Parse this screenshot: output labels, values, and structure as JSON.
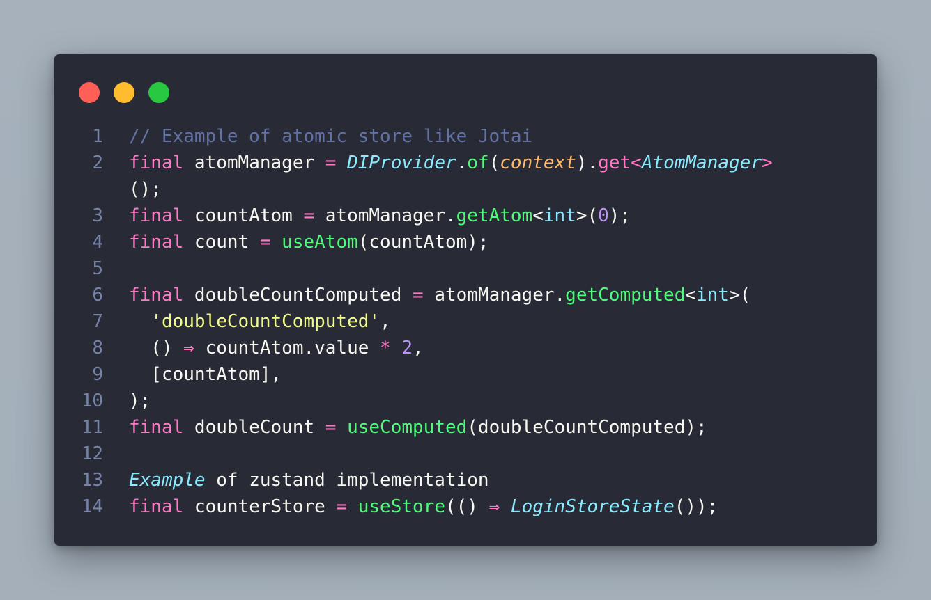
{
  "window": {
    "traffic_lights": [
      "close",
      "minimize",
      "maximize"
    ],
    "colors": {
      "background": "#282a36",
      "close": "#ff5f57",
      "minimize": "#febc2e",
      "maximize": "#28c840"
    }
  },
  "code": {
    "lines": [
      {
        "number": "1",
        "tokens": [
          {
            "t": "cm",
            "v": "// Example of atomic store like Jotai"
          }
        ]
      },
      {
        "number": "2",
        "tokens": [
          {
            "t": "kw",
            "v": "final"
          },
          {
            "t": "id",
            "v": " atomManager "
          },
          {
            "t": "op",
            "v": "="
          },
          {
            "t": "id",
            "v": " "
          },
          {
            "t": "cls",
            "v": "DIProvider"
          },
          {
            "t": "pun",
            "v": "."
          },
          {
            "t": "fn",
            "v": "of"
          },
          {
            "t": "pun",
            "v": "("
          },
          {
            "t": "param",
            "v": "context"
          },
          {
            "t": "pun",
            "v": ")."
          },
          {
            "t": "kw",
            "v": "get"
          },
          {
            "t": "op",
            "v": "<"
          },
          {
            "t": "cls",
            "v": "AtomManager"
          },
          {
            "t": "op",
            "v": ">"
          }
        ]
      },
      {
        "number": "",
        "tokens": [
          {
            "t": "pun",
            "v": "();"
          }
        ]
      },
      {
        "number": "3",
        "tokens": [
          {
            "t": "kw",
            "v": "final"
          },
          {
            "t": "id",
            "v": " countAtom "
          },
          {
            "t": "op",
            "v": "="
          },
          {
            "t": "id",
            "v": " atomManager."
          },
          {
            "t": "fn",
            "v": "getAtom"
          },
          {
            "t": "pun",
            "v": "<"
          },
          {
            "t": "type",
            "v": "int"
          },
          {
            "t": "pun",
            "v": ">("
          },
          {
            "t": "num",
            "v": "0"
          },
          {
            "t": "pun",
            "v": ");"
          }
        ]
      },
      {
        "number": "4",
        "tokens": [
          {
            "t": "kw",
            "v": "final"
          },
          {
            "t": "id",
            "v": " count "
          },
          {
            "t": "op",
            "v": "="
          },
          {
            "t": "id",
            "v": " "
          },
          {
            "t": "fn",
            "v": "useAtom"
          },
          {
            "t": "pun",
            "v": "(countAtom);"
          }
        ]
      },
      {
        "number": "5",
        "tokens": []
      },
      {
        "number": "6",
        "tokens": [
          {
            "t": "kw",
            "v": "final"
          },
          {
            "t": "id",
            "v": " doubleCountComputed "
          },
          {
            "t": "op",
            "v": "="
          },
          {
            "t": "id",
            "v": " atomManager."
          },
          {
            "t": "fn",
            "v": "getComputed"
          },
          {
            "t": "pun",
            "v": "<"
          },
          {
            "t": "type",
            "v": "int"
          },
          {
            "t": "pun",
            "v": ">("
          }
        ]
      },
      {
        "number": "7",
        "tokens": [
          {
            "t": "id",
            "v": "  "
          },
          {
            "t": "str",
            "v": "'doubleCountComputed'"
          },
          {
            "t": "pun",
            "v": ","
          }
        ]
      },
      {
        "number": "8",
        "tokens": [
          {
            "t": "id",
            "v": "  () "
          },
          {
            "t": "op",
            "v": "⇒"
          },
          {
            "t": "id",
            "v": " countAtom.value "
          },
          {
            "t": "op",
            "v": "*"
          },
          {
            "t": "id",
            "v": " "
          },
          {
            "t": "num",
            "v": "2"
          },
          {
            "t": "pun",
            "v": ","
          }
        ]
      },
      {
        "number": "9",
        "tokens": [
          {
            "t": "id",
            "v": "  [countAtom],"
          }
        ]
      },
      {
        "number": "10",
        "tokens": [
          {
            "t": "pun",
            "v": ");"
          }
        ]
      },
      {
        "number": "11",
        "tokens": [
          {
            "t": "kw",
            "v": "final"
          },
          {
            "t": "id",
            "v": " doubleCount "
          },
          {
            "t": "op",
            "v": "="
          },
          {
            "t": "id",
            "v": " "
          },
          {
            "t": "fn",
            "v": "useComputed"
          },
          {
            "t": "pun",
            "v": "(doubleCountComputed);"
          }
        ]
      },
      {
        "number": "12",
        "tokens": []
      },
      {
        "number": "13",
        "tokens": [
          {
            "t": "it-cls",
            "v": "Example"
          },
          {
            "t": "id",
            "v": " of zustand implementation"
          }
        ]
      },
      {
        "number": "14",
        "tokens": [
          {
            "t": "kw",
            "v": "final"
          },
          {
            "t": "id",
            "v": " counterStore "
          },
          {
            "t": "op",
            "v": "="
          },
          {
            "t": "id",
            "v": " "
          },
          {
            "t": "fn",
            "v": "useStore"
          },
          {
            "t": "pun",
            "v": "(() "
          },
          {
            "t": "op",
            "v": "⇒"
          },
          {
            "t": "id",
            "v": " "
          },
          {
            "t": "cls",
            "v": "LoginStoreState"
          },
          {
            "t": "pun",
            "v": "());"
          }
        ]
      }
    ]
  }
}
